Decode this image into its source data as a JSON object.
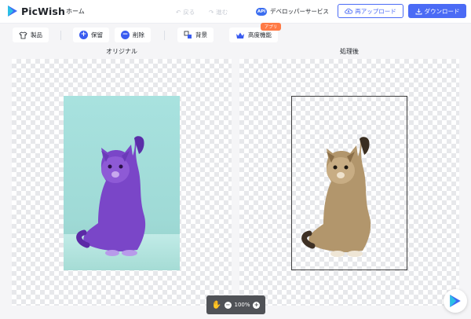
{
  "header": {
    "app_name": "PicWish",
    "nav_home": "ホーム",
    "undo_label": "戻る",
    "redo_label": "進む",
    "api_badge": "API",
    "api_label": "デベロッパーサービス",
    "reupload_label": "再アップロード",
    "download_label": "ダウンロード"
  },
  "toolbar": {
    "products_label": "製品",
    "keep_label": "保留",
    "erase_label": "削除",
    "background_label": "背景",
    "advanced_label": "高度機能",
    "app_badge": "アプリ"
  },
  "panels": {
    "original_label": "オリジナル",
    "processed_label": "処理後"
  },
  "zoom": {
    "level": "100%"
  },
  "colors": {
    "accent": "#4b6bf5",
    "badge": "#ff7a45",
    "photo_bg": "#a8e2df"
  },
  "icons": {
    "logo": "picwish-logo-icon",
    "undo": "undo-icon",
    "redo": "redo-icon",
    "upload": "cloud-upload-icon",
    "download": "download-icon",
    "products": "shirt-icon",
    "keep": "plus-circle-icon",
    "erase": "minus-circle-icon",
    "background": "layers-icon",
    "advanced": "crown-icon",
    "hand": "hand-icon",
    "zoom_out": "zoom-out-icon",
    "zoom_in": "zoom-in-icon",
    "fab": "picwish-fab-icon"
  }
}
